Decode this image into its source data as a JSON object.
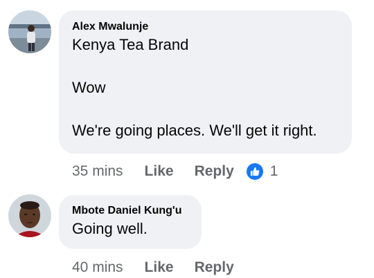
{
  "comments": [
    {
      "author": "Alex Mwalunje",
      "lines": [
        "Kenya Tea Brand",
        "Wow",
        "We're going places. We'll get it right."
      ],
      "time": "35 mins",
      "like_label": "Like",
      "reply_label": "Reply",
      "reaction_icon": "thumbs-up-icon",
      "reaction_count": "1"
    },
    {
      "author": "Mbote Daniel Kung'u",
      "lines": [
        "Going well."
      ],
      "time": "40 mins",
      "like_label": "Like",
      "reply_label": "Reply"
    }
  ],
  "colors": {
    "bubble": "#eff1f4",
    "meta_text": "#65676b",
    "like_blue": "#1877f2"
  }
}
